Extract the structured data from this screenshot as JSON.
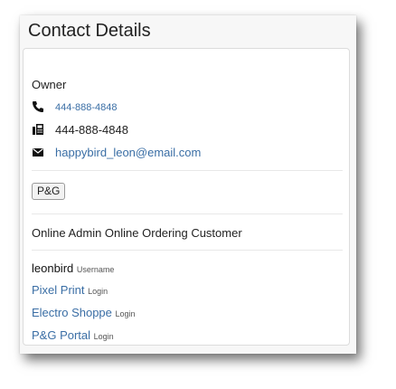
{
  "card": {
    "title": "Contact Details"
  },
  "contact": {
    "role": "Owner",
    "phone_link": "444-888-4848",
    "fax": "444-888-4848",
    "email": "happybird_leon@email.com"
  },
  "tags": {
    "badge": "P&G"
  },
  "account": {
    "type_line": "Online Admin Online Ordering Customer",
    "username": "leonbird",
    "username_suffix": "Username",
    "logins": [
      {
        "name": "Pixel Print",
        "suffix": "Login"
      },
      {
        "name": "Electro Shoppe",
        "suffix": "Login"
      },
      {
        "name": "P&G Portal",
        "suffix": "Login"
      }
    ]
  },
  "icons": {
    "phone": "phone-icon",
    "fax": "fax-icon",
    "email": "envelope-icon"
  },
  "colors": {
    "link": "#3a6ea5",
    "text": "#222222"
  }
}
